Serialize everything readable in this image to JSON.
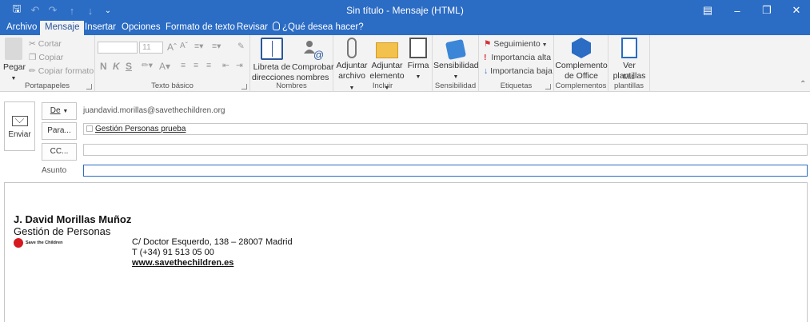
{
  "window": {
    "title": "Sin título  -  Mensaje (HTML)"
  },
  "tabs": [
    {
      "label": "Archivo"
    },
    {
      "label": "Mensaje"
    },
    {
      "label": "Insertar"
    },
    {
      "label": "Opciones"
    },
    {
      "label": "Formato de texto"
    },
    {
      "label": "Revisar"
    },
    {
      "label": "¿Qué desea hacer?"
    }
  ],
  "ribbon": {
    "portapapeles": {
      "label": "Portapapeles",
      "paste": "Pegar",
      "cut": "Cortar",
      "copy": "Copiar",
      "format_painter": "Copiar formato"
    },
    "texto_basico": {
      "label": "Texto básico",
      "font_size": "11",
      "bold": "N",
      "italic": "K",
      "underline": "S"
    },
    "nombres": {
      "label": "Nombres",
      "address_book": "Libreta de direcciones",
      "check_names": "Comprobar nombres"
    },
    "incluir": {
      "label": "Incluir",
      "attach_file": "Adjuntar archivo",
      "attach_item": "Adjuntar elemento",
      "signature": "Firma"
    },
    "sensibilidad": {
      "label": "Sensibilidad",
      "sensitivity": "Sensibilidad"
    },
    "etiquetas": {
      "label": "Etiquetas",
      "follow_up": "Seguimiento",
      "high_importance": "Importancia alta",
      "low_importance": "Importancia baja"
    },
    "complementos": {
      "label": "Complementos",
      "office_addins": "Complemento de Office"
    },
    "mis_plantillas": {
      "label": "Mis plantillas",
      "view_templates": "Ver plantillas"
    }
  },
  "compose": {
    "send_label": "Enviar",
    "from_label": "De",
    "from_value": "juandavid.morillas@savethechildren.org",
    "to_label": "Para...",
    "to_value": "Gestión Personas prueba",
    "cc_label": "CC...",
    "cc_value": "",
    "subject_label": "Asunto",
    "subject_value": ""
  },
  "signature": {
    "name": "J. David Morillas Muñoz",
    "role": "Gestión de Personas",
    "logo_text": "Save the Children",
    "address": "C/ Doctor Esquerdo, 138 – 28007 Madrid",
    "phone": "T  (+34) 91 513 05 00",
    "website": "www.savethechildren.es"
  }
}
